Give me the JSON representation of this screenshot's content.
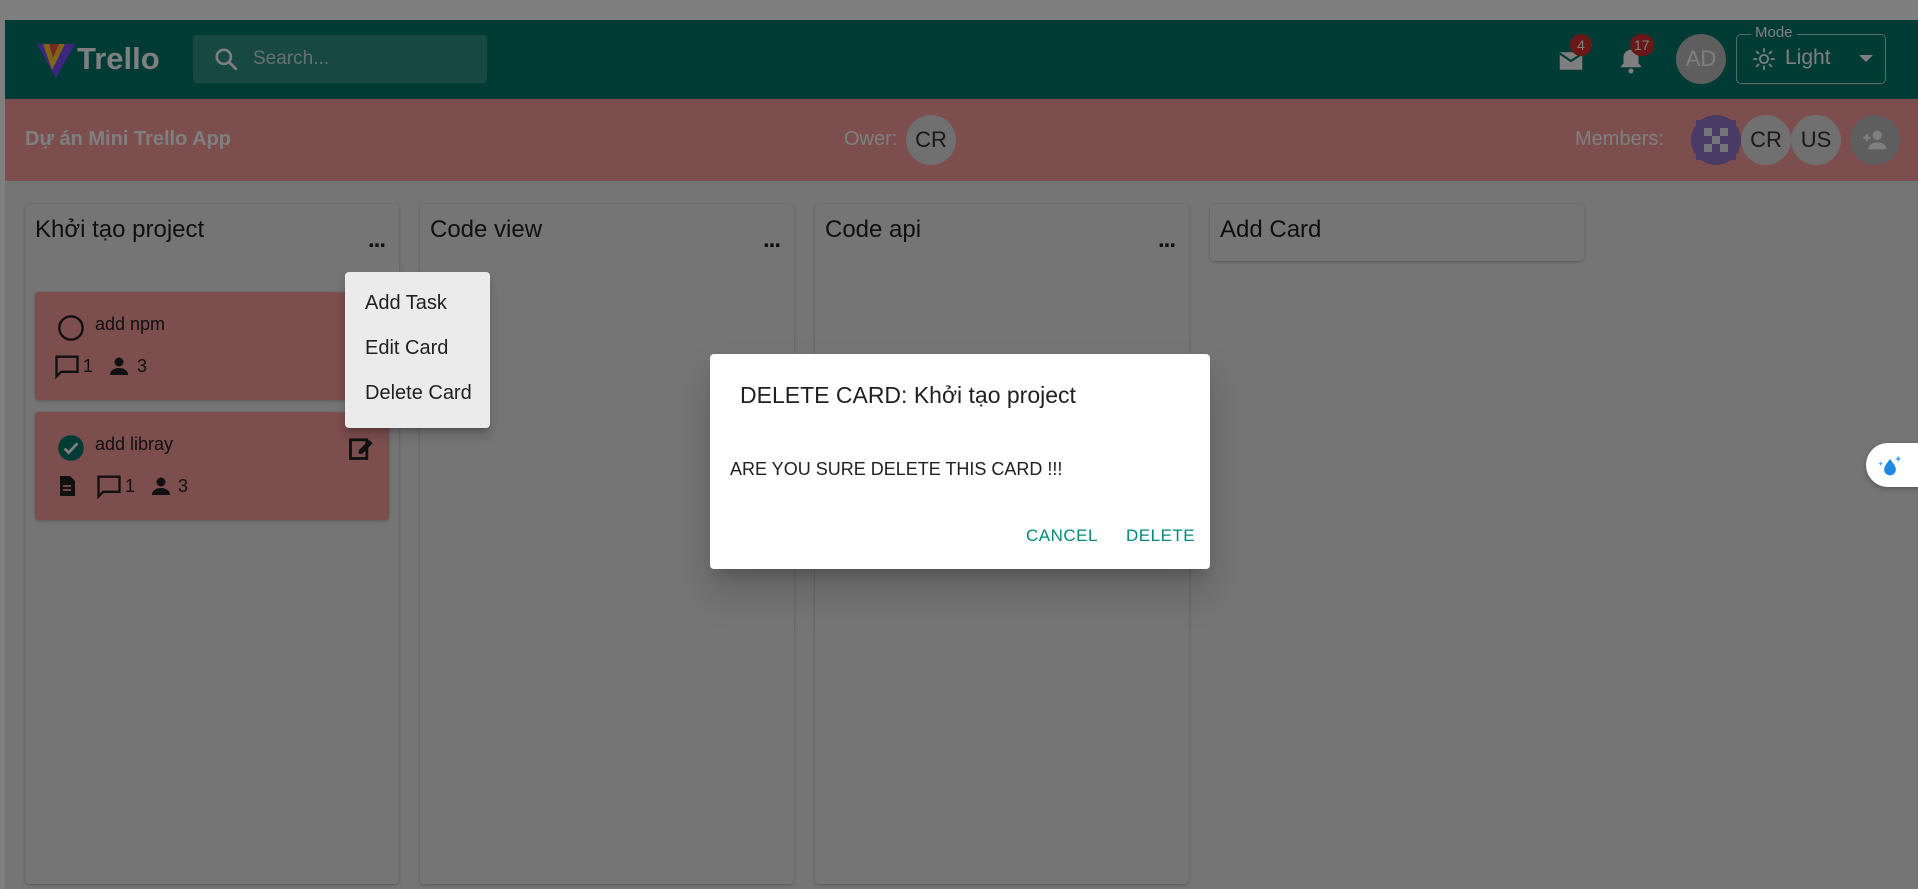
{
  "header": {
    "logo_text": "Trello",
    "search_placeholder": "Search...",
    "mail_badge": "4",
    "notif_badge": "17",
    "user_initials": "AD",
    "mode_label": "Mode",
    "mode_value": "Light",
    "bg_color": "#00796b"
  },
  "board": {
    "title": "Dự án Mini Trello App",
    "owner_label": "Ower:",
    "owner_initials": "CR",
    "members_label": "Members:",
    "members": [
      "CR",
      "US"
    ],
    "bar_color": "#fa9d9d"
  },
  "columns": [
    {
      "title": "Khởi tạo project",
      "more": "...",
      "cards": [
        {
          "name": "add npm",
          "done": false,
          "comments": "1",
          "members": "3",
          "attachment": false
        },
        {
          "name": "add libray",
          "done": true,
          "comments": "1",
          "members": "3",
          "attachment": true
        }
      ]
    },
    {
      "title": "Code view",
      "more": "..."
    },
    {
      "title": "Code api",
      "more": "..."
    },
    {
      "title": "Add Card"
    }
  ],
  "menu": {
    "items": [
      "Add Task",
      "Edit Card",
      "Delete Card"
    ]
  },
  "dialog": {
    "title": "DELETE CARD: Khởi tạo project",
    "message": "ARE YOU SURE DELETE THIS CARD !!!",
    "cancel": "CANCEL",
    "delete": "DELETE",
    "accent": "#00897b"
  }
}
